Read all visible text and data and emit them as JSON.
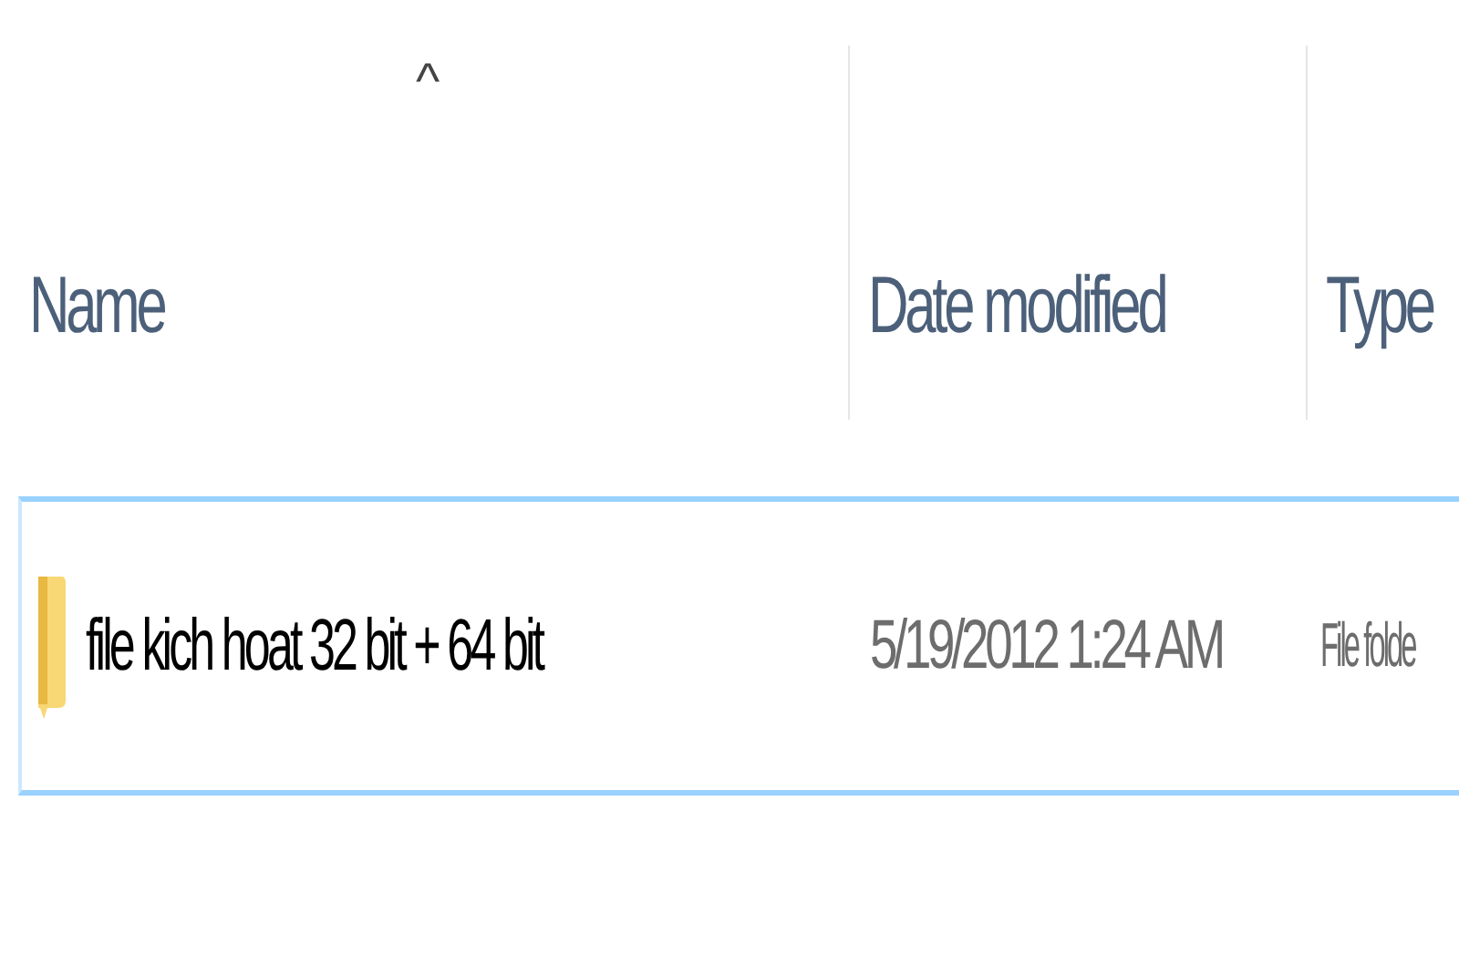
{
  "columns": [
    {
      "label": "Name",
      "sort_indicator": "^"
    },
    {
      "label": "Date modified"
    },
    {
      "label": "Type"
    }
  ],
  "rows": [
    {
      "kind": "folder",
      "name": "file kich hoat 32 bit + 64 bit",
      "date_modified": "5/19/2012 1:24 AM",
      "type": "File folde",
      "selected": true
    }
  ]
}
